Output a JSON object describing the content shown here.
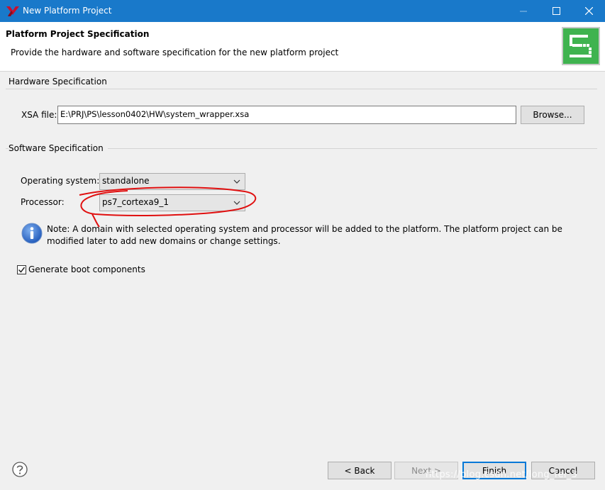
{
  "window": {
    "title": "New Platform Project",
    "icons": {
      "app": "xilinx-logo-icon",
      "minimize": "minimize-icon",
      "maximize": "maximize-icon",
      "close": "close-icon"
    }
  },
  "header": {
    "title": "Platform Project Specification",
    "description": "Provide the hardware and software specification for the new platform project",
    "banner_icon": "platform-banner-icon",
    "accent_color": "#3fb34f"
  },
  "hardware": {
    "section_label": "Hardware Specification",
    "xsa_label": "XSA file:",
    "xsa_value": "E:\\PRJ\\PS\\lesson0402\\HW\\system_wrapper.xsa",
    "browse_label": "Browse..."
  },
  "software": {
    "section_label": "Software Specification",
    "os_label": "Operating system:",
    "os_value": "standalone",
    "processor_label": "Processor:",
    "processor_value": "ps7_cortexa9_1",
    "note": "Note: A domain with selected operating system and processor will be added to the platform. The platform project can be modified later to add new domains or change settings.",
    "info_icon": "info-icon",
    "annotation_color": "#e01010"
  },
  "boot": {
    "checkbox_label": "Generate boot components",
    "checked": true
  },
  "footer": {
    "help_icon": "help-icon",
    "back_label": "< Back",
    "next_label": "Next >",
    "finish_label": "Finish",
    "cancel_label": "Cancel"
  },
  "watermark": "https://blog.csdn.net/long_fei_3"
}
